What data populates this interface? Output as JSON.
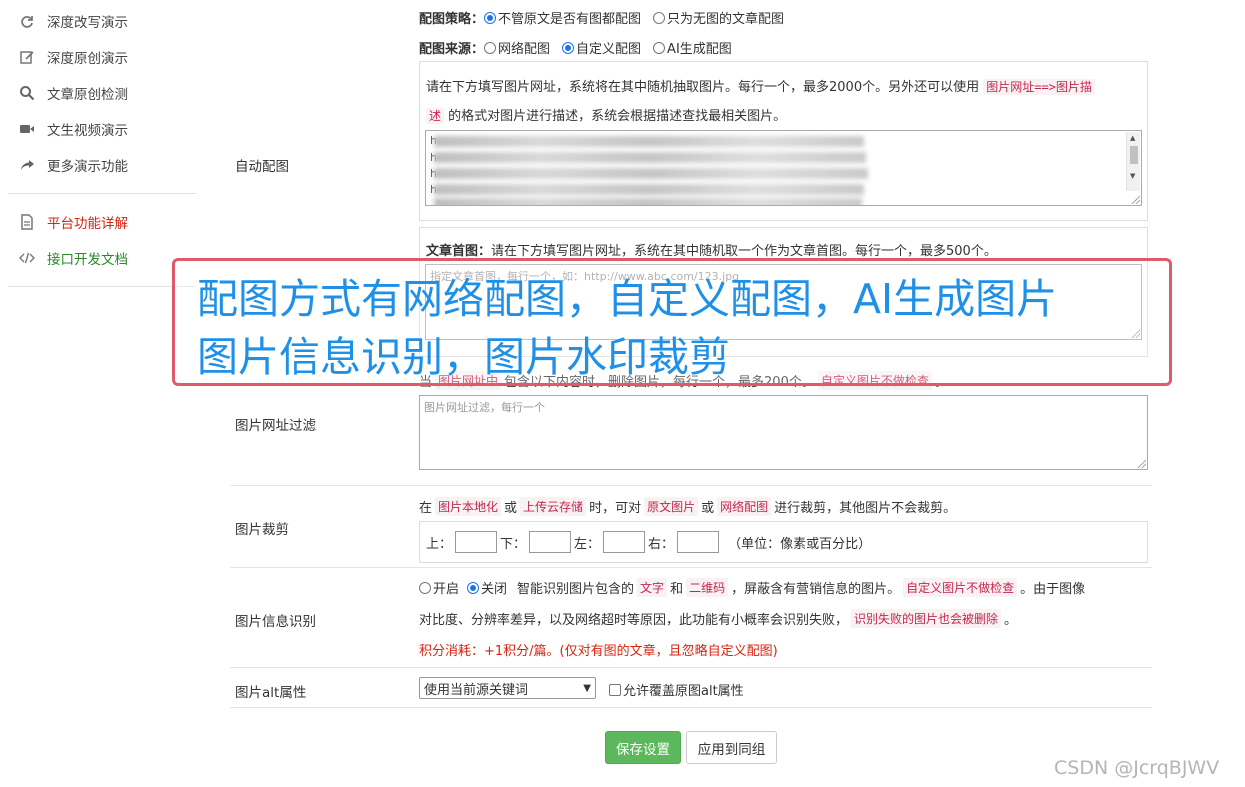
{
  "sidebar": {
    "items": [
      {
        "label": "深度改写演示",
        "icon": "refresh-icon"
      },
      {
        "label": "深度原创演示",
        "icon": "edit-icon"
      },
      {
        "label": "文章原创检测",
        "icon": "search-icon"
      },
      {
        "label": "文生视频演示",
        "icon": "video-icon"
      },
      {
        "label": "更多演示功能",
        "icon": "share-icon"
      }
    ],
    "links": [
      {
        "label": "平台功能详解",
        "icon": "document-icon",
        "color": "#d9230f"
      },
      {
        "label": "接口开发文档",
        "icon": "code-icon",
        "color": "#2a8a2a"
      }
    ]
  },
  "strategy": {
    "label": "配图策略：",
    "options": [
      "不管原文是否有图都配图",
      "只为无图的文章配图"
    ],
    "selected": 0
  },
  "source": {
    "label": "配图来源：",
    "options": [
      "网络配图",
      "自定义配图",
      "AI生成配图"
    ],
    "selected": 1
  },
  "auto_image": {
    "row_label": "自动配图",
    "desc_line1": "请在下方填写图片网址，系统将在其中随机抽取图片。每行一个，最多2000个。另外还可以使用",
    "code1": "图片网址==>图片描",
    "code1b": "述",
    "desc_line2": "的格式对图片进行描述，系统会根据描述查找最相关图片。",
    "url_prefix": "h"
  },
  "cover": {
    "label": "文章首图：",
    "desc": "请在下方填写图片网址，系统在其中随机取一个作为文章首图。每行一个，最多500个。",
    "placeholder": "指定文章首图，每行一个，如：http://www.abc.com/123.jpg"
  },
  "url_filter": {
    "row_label": "图片网址过滤",
    "desc_pre": "当",
    "code1": "图片网址中",
    "desc_mid": "包含以下内容时，删除图片，每行一个，最多200个。",
    "code2": "自定义图片不做检查",
    "desc_end": "。",
    "placeholder": "图片网址过滤，每行一个"
  },
  "crop": {
    "row_label": "图片裁剪",
    "desc_pre": "在",
    "code1": "图片本地化",
    "or1": "或",
    "code2": "上传云存储",
    "mid": "时，可对",
    "code3": "原文图片",
    "or2": "或",
    "code4": "网络配图",
    "end": "进行裁剪，其他图片不会裁剪。",
    "top": "上：",
    "bottom": "下：",
    "left": "左：",
    "right": "右：",
    "unit": "（单位：像素或百分比）"
  },
  "recognition": {
    "row_label": "图片信息识别",
    "on_label": "开启",
    "off_label": "关闭",
    "selected": "off",
    "desc1": "智能识别图片包含的",
    "code1": "文字",
    "and": "和",
    "code2": "二维码",
    "desc2": "，屏蔽含有营销信息的图片。",
    "code3": "自定义图片不做检查",
    "desc3": "。由于图像",
    "line2": "对比度、分辨率差异，以及网络超时等原因，此功能有小概率会识别失败，",
    "code4": "识别失败的图片也会被删除",
    "line2_end": "。",
    "cost": "积分消耗：+1积分/篇。(仅对有图的文章，且忽略自定义配图)"
  },
  "alt": {
    "row_label": "图片alt属性",
    "select_value": "使用当前源关键词",
    "checkbox_label": "允许覆盖原图alt属性"
  },
  "buttons": {
    "save": "保存设置",
    "apply": "应用到同组"
  },
  "overlay": {
    "line1": "配图方式有网络配图，自定义配图，AI生成图片",
    "line2": "图片信息识别，图片水印裁剪"
  },
  "watermark": "CSDN @JcrqBJWV"
}
